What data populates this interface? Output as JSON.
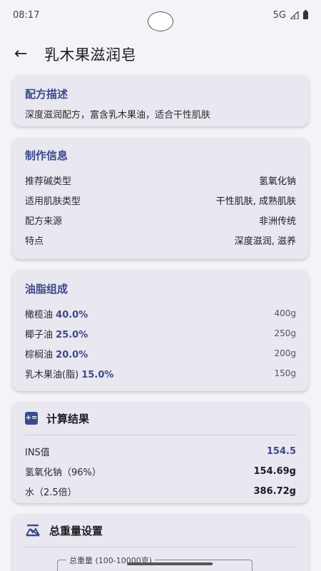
{
  "status": {
    "time": "08:17",
    "network": "5G"
  },
  "header": {
    "title": "乳木果滋润皂"
  },
  "description": {
    "title": "配方描述",
    "text": "深度滋润配方，富含乳木果油，适合干性肌肤"
  },
  "info": {
    "title": "制作信息",
    "rows": [
      {
        "label": "推荐碱类型",
        "value": "氢氧化钠"
      },
      {
        "label": "适用肌肤类型",
        "value": "干性肌肤, 成熟肌肤"
      },
      {
        "label": "配方来源",
        "value": "非洲传统"
      },
      {
        "label": "特点",
        "value": "深度滋润, 滋养"
      }
    ]
  },
  "oils": {
    "title": "油脂组成",
    "items": [
      {
        "name": "橄榄油",
        "percent": "40.0%",
        "grams": "400g"
      },
      {
        "name": "椰子油",
        "percent": "25.0%",
        "grams": "250g"
      },
      {
        "name": "棕榈油",
        "percent": "20.0%",
        "grams": "200g"
      },
      {
        "name": "乳木果油(脂)",
        "percent": "15.0%",
        "grams": "150g"
      }
    ]
  },
  "results": {
    "title": "计算结果",
    "icon": "calculator-icon",
    "rows": [
      {
        "label": "INS值",
        "value": "154.5"
      },
      {
        "label": "氢氧化钠（96%）",
        "value": "154.69g"
      },
      {
        "label": "水（2.5倍）",
        "value": "386.72g"
      }
    ]
  },
  "weight": {
    "title": "总重量设置",
    "icon": "scale-icon",
    "field_label": "总重量 (100-10000克)"
  },
  "colors": {
    "accent": "#3b4a8c",
    "card": "#e9e7ef",
    "background": "#f4f3f8"
  }
}
